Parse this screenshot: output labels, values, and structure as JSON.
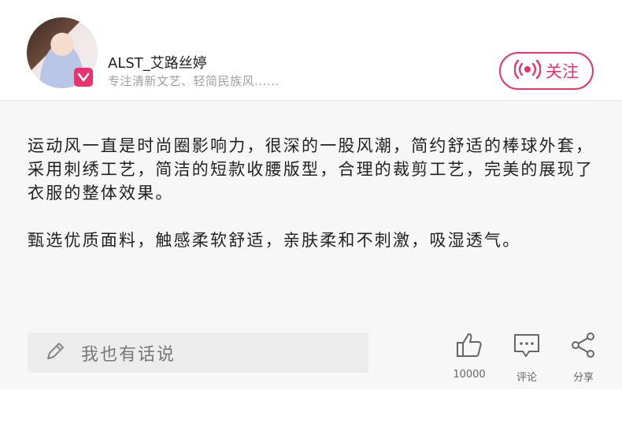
{
  "author": {
    "name": "ALST_艾路丝婷",
    "bio": "专注清新文艺、轻简民族风......"
  },
  "follow": {
    "label": "关注"
  },
  "post": {
    "paragraph_1": "运动风一直是时尚圈影响力，很深的一股风潮，简约舒适的棒球外套，采用刺绣工艺，简洁的短款收腰版型，合理的裁剪工艺，完美的展现了衣服的整体效果。",
    "paragraph_2": "甄选优质面料，触感柔软舒适，亲肤柔和不刺激，吸湿透气。"
  },
  "comment": {
    "placeholder": "我也有话说"
  },
  "actions": {
    "like_count": "10000",
    "comment_label": "评论",
    "share_label": "分享"
  },
  "colors": {
    "accent": "#e8336d",
    "background": "#f7f7f7"
  },
  "icons": [
    "verified-v-icon",
    "broadcast-icon",
    "pencil-icon",
    "thumbs-up-icon",
    "comment-icon",
    "share-icon"
  ]
}
